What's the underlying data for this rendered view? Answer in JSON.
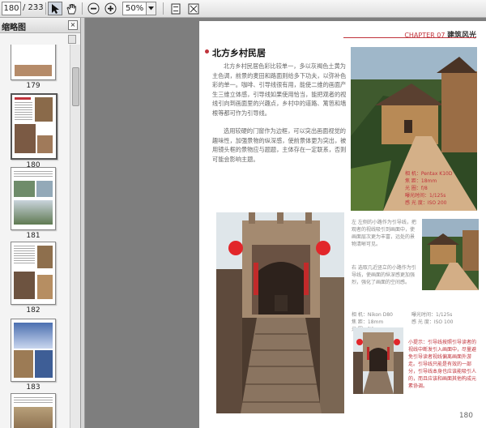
{
  "toolbar": {
    "page_current": "180",
    "page_total": "/ 233",
    "zoom_value": "50%"
  },
  "sidebar": {
    "title": "缩略图",
    "close_glyph": "×",
    "thumbs": [
      {
        "num": "179"
      },
      {
        "num": "180"
      },
      {
        "num": "181"
      },
      {
        "num": "182"
      },
      {
        "num": "183"
      },
      {
        "num": ""
      }
    ]
  },
  "page": {
    "chapter_tag": "CHAPTER 07",
    "chapter_title": "建筑风光",
    "section_title": "北方乡村民居",
    "para1": "北方乡村民居色彩比较单一，多以灰褐色土黄为主色调，前景的麦田和路面则给多下功夫，以弥补色彩的单一。咖啡、引导线很有用，能使二维的画面产生三维立体感，引导线如果使用恰当，能把观者的视线引向到画面里的兴趣点，乡村中的道路、篱笆和墙根等都可作为引导线。",
    "para2": "选用较硬的门窗作为边框，可以突出画面视觉的趣味性，加强景物的纵深感，使前景体更为突出，被用镜头框的景物应与题题，主体存在一定联系，否则可能会影响主题。",
    "cap1": "相 机：Pentax K10D\n焦 距：18mm\n光 圈：f/8\n曝光时间：1/125s\n感 光 度：ISO 200",
    "cap2": "左 左侧的小路作为引导线，把观者的视线吸引到画面中，使画面层次更为丰富，远处的景物清晰可见。",
    "cap3": "右 选取几近竖立的小路作为引导线，使画面的纵深感更加强烈，强化了画面的空间感。",
    "cap4": "相 机：Nikon D80\n焦 距：18mm\n光 圈：f/8",
    "cap5": "曝光时间：1/125s\n感 光 度：ISO 100",
    "cap6": "小提示：引导线按照引导读者的视线中断发引入画面中，尽量避免引导读者视线偏离画面外游走。引导线只能是有效的一部分，引导线本身也应该能吸引人的，而且应该和画面其他构成元素协调。",
    "page_number": "180"
  }
}
